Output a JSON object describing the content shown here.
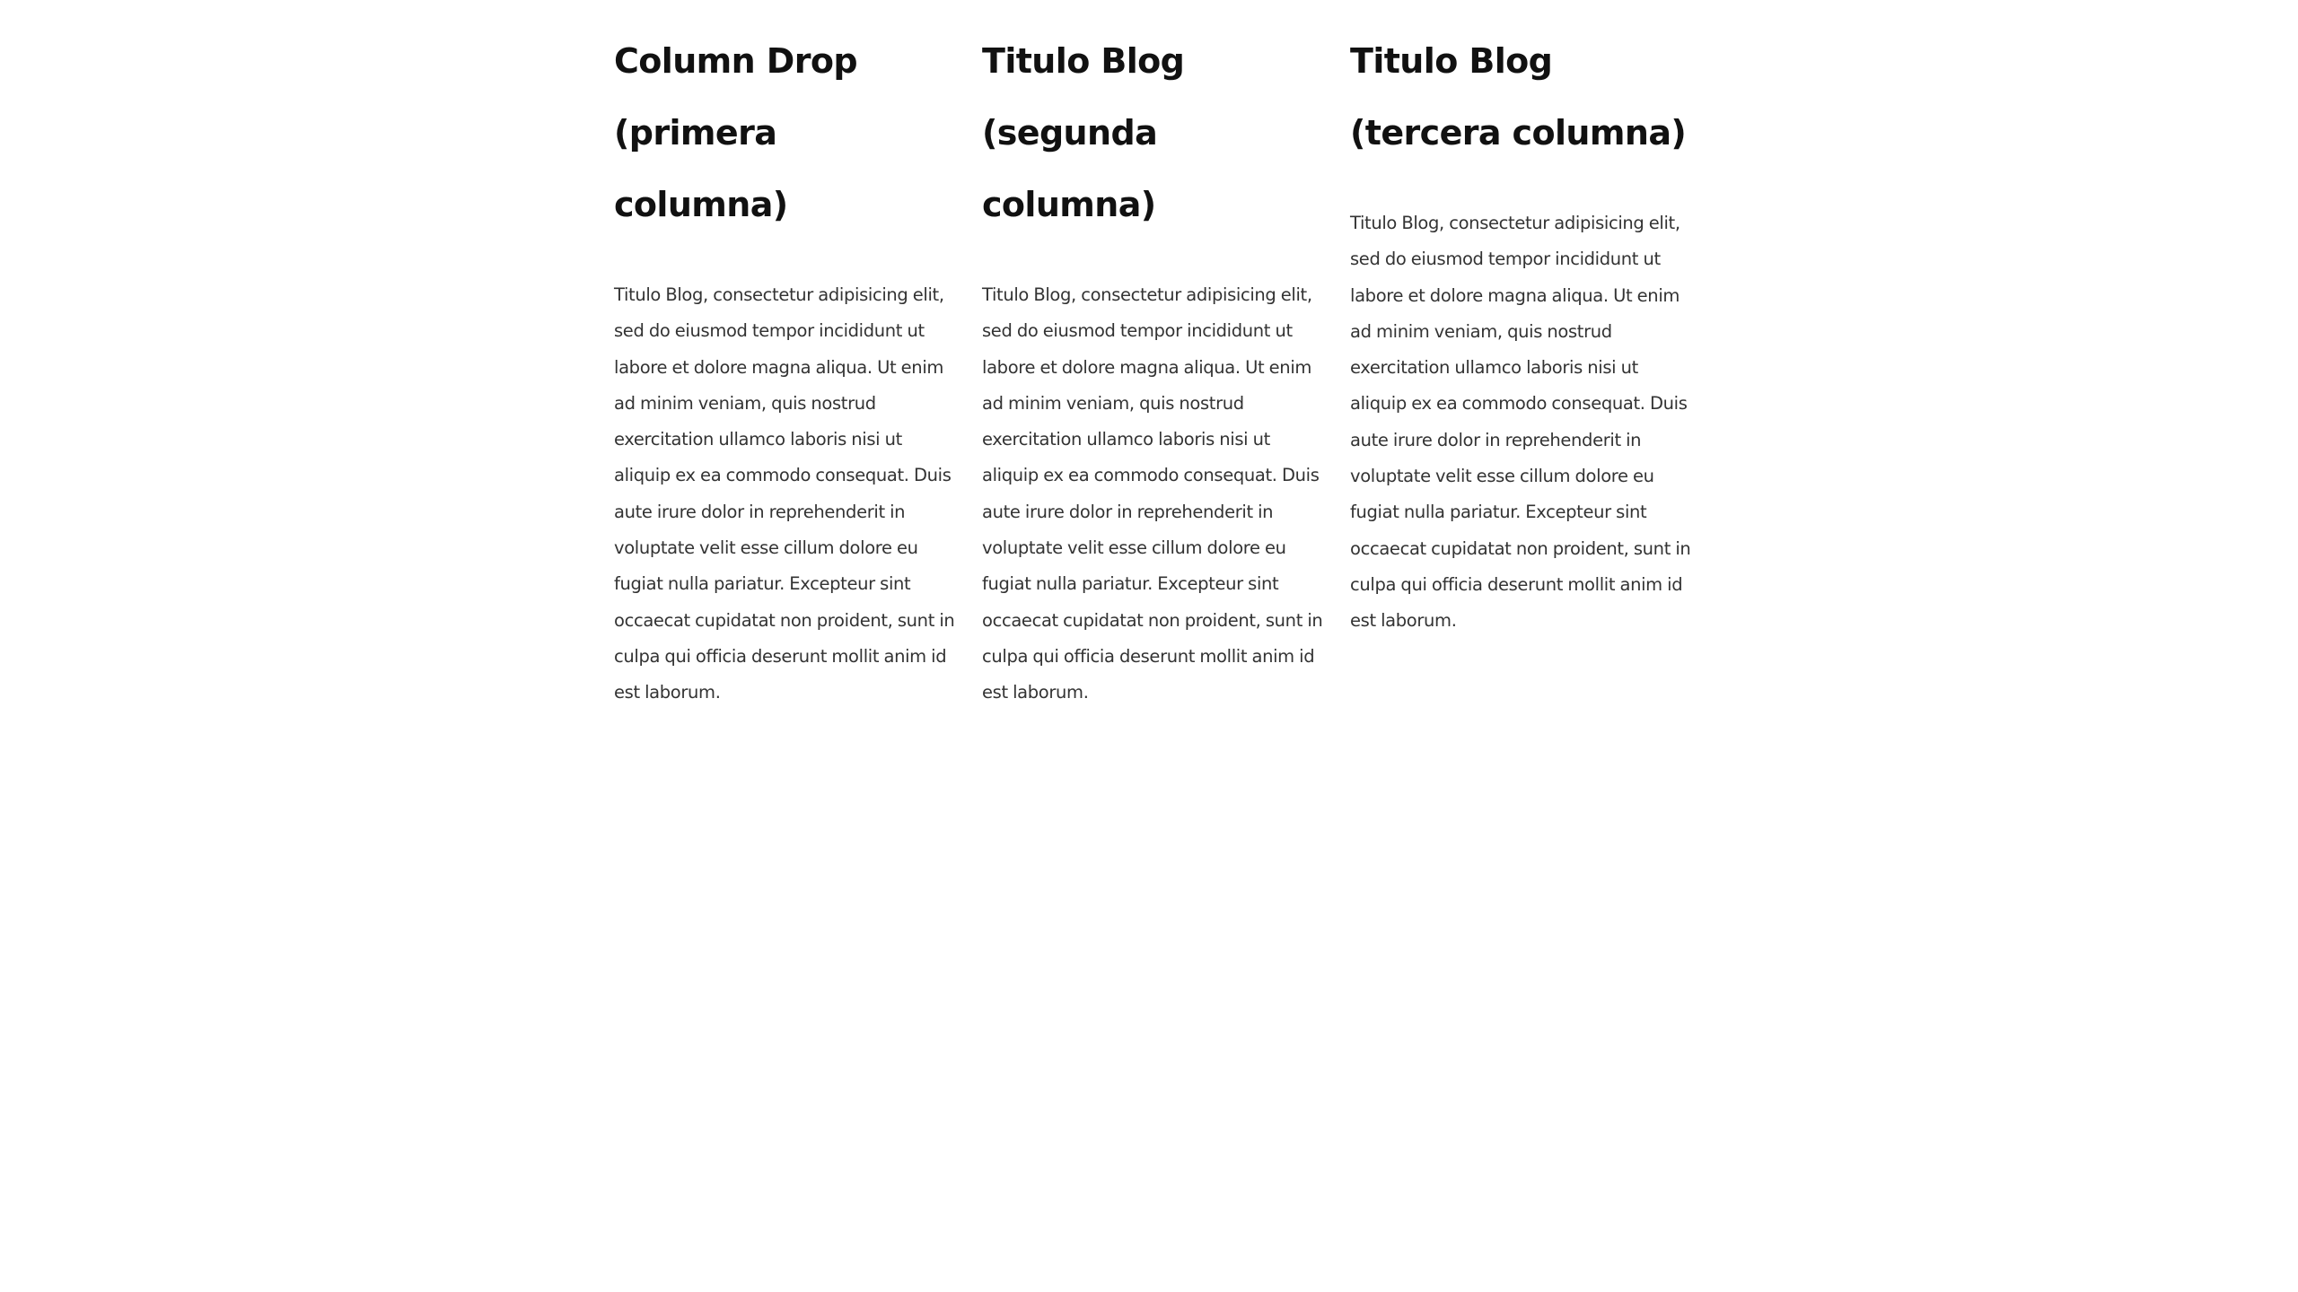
{
  "columns": [
    {
      "title": "Column Drop (primera columna)",
      "body": "Titulo Blog, consectetur adipisicing elit, sed do eiusmod tempor incididunt ut labore et dolore magna aliqua. Ut enim ad minim veniam, quis nostrud exercitation ullamco laboris nisi ut aliquip ex ea commodo consequat. Duis aute irure dolor in reprehenderit in voluptate velit esse cillum dolore eu fugiat nulla pariatur. Excepteur sint occaecat cupidatat non proident, sunt in culpa qui officia deserunt mollit anim id est laborum."
    },
    {
      "title": "Titulo Blog (segunda columna)",
      "body": "Titulo Blog, consectetur adipisicing elit, sed do eiusmod tempor incididunt ut labore et dolore magna aliqua. Ut enim ad minim veniam, quis nostrud exercitation ullamco laboris nisi ut aliquip ex ea commodo consequat. Duis aute irure dolor in reprehenderit in voluptate velit esse cillum dolore eu fugiat nulla pariatur. Excepteur sint occaecat cupidatat non proident, sunt in culpa qui officia deserunt mollit anim id est laborum."
    },
    {
      "title": "Titulo Blog (tercera columna)",
      "body": "Titulo Blog, consectetur adipisicing elit, sed do eiusmod tempor incididunt ut labore et dolore magna aliqua. Ut enim ad minim veniam, quis nostrud exercitation ullamco laboris nisi ut aliquip ex ea commodo consequat. Duis aute irure dolor in reprehenderit in voluptate velit esse cillum dolore eu fugiat nulla pariatur. Excepteur sint occaecat cupidatat non proident, sunt in culpa qui officia deserunt mollit anim id est laborum."
    }
  ]
}
